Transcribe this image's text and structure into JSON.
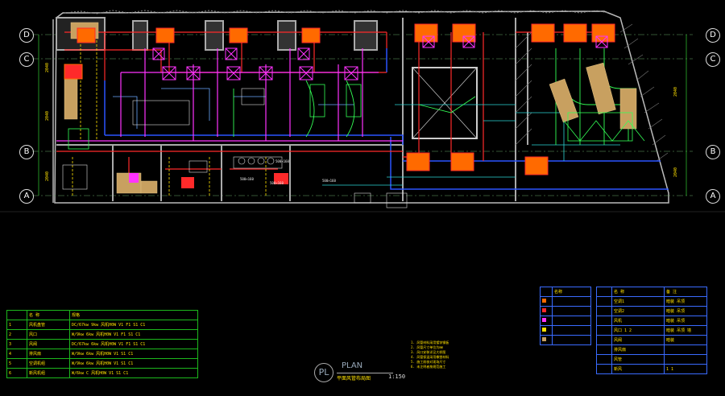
{
  "grid_axes": {
    "left": [
      "D",
      "C",
      "B",
      "A"
    ],
    "right": [
      "D",
      "C",
      "B",
      "A"
    ]
  },
  "duct_labels": [
    "500×160",
    "500×160",
    "500×160",
    "500×160"
  ],
  "title_block": {
    "symbol": "PL",
    "title": "PLAN",
    "subtitle": "平面风管布局图",
    "scale": "1:150"
  },
  "legend_left": {
    "header": [
      "",
      "名 称",
      "规格"
    ],
    "rows": [
      [
        "1",
        "风机盘管",
        "DC/67kw 9kw 风机H0W V1 F1 S1 C1"
      ],
      [
        "2",
        "风口",
        "W/9kw 6kw 风机H0W V1 F1 S1 C1"
      ],
      [
        "3",
        "风阀",
        "DC/67kw 6kw 风机H0W V1 F1 S1 C1"
      ],
      [
        "4",
        "排风扇",
        "W/9kw 6kw 风机H0W V1 S1 C1"
      ],
      [
        "5",
        "空调机组",
        "W/9kw 6kw 风机H0W V1 S1 C1"
      ],
      [
        "6",
        "新风机组",
        "W/6kw C 风机H0W V1 S1 C1"
      ]
    ]
  },
  "legend_mid": {
    "header": [
      "",
      "名称"
    ],
    "rows": [
      [
        "",
        ""
      ],
      [
        "",
        ""
      ],
      [
        "",
        ""
      ],
      [
        "",
        ""
      ],
      [
        "",
        ""
      ]
    ]
  },
  "legend_right": {
    "header": [
      "",
      "名 称",
      "备 注"
    ],
    "rows": [
      [
        "",
        "空调1",
        "暗装 吊顶"
      ],
      [
        "",
        "空调2",
        "暗装 吊顶"
      ],
      [
        "",
        "风机",
        "暗装 吊顶"
      ],
      [
        "",
        "风口 1 2",
        "暗装 吊顶 墙"
      ],
      [
        "",
        "风阀",
        "暗装"
      ],
      [
        "",
        "排风扇",
        ""
      ],
      [
        "",
        "风管",
        ""
      ],
      [
        "",
        "新风",
        "1 1"
      ]
    ]
  },
  "notes": [
    "1. 风管材料采用镀锌钢板",
    "2. 风管尺寸单位为mm",
    "3. 风口安装详见大样图",
    "4. 风管保温采用橡塑材料",
    "5. 施工前核对现场尺寸",
    "6. 未注明者按规范施工"
  ]
}
